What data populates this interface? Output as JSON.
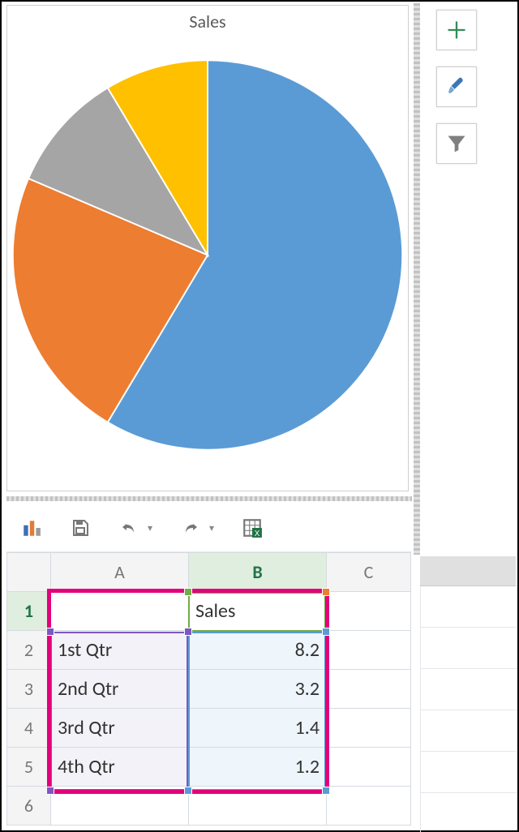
{
  "chart_data": {
    "type": "pie",
    "title": "Sales",
    "categories": [
      "1st Qtr",
      "2nd Qtr",
      "3rd Qtr",
      "4th Qtr"
    ],
    "values": [
      8.2,
      3.2,
      1.4,
      1.2
    ],
    "colors": [
      "#5b9bd5",
      "#ed7d31",
      "#a5a5a5",
      "#ffc000"
    ]
  },
  "side_buttons": {
    "add": "plus-icon",
    "styles": "paintbrush-icon",
    "filter": "funnel-icon"
  },
  "qat": {
    "chart_type": "chart-type-icon",
    "save": "save-icon",
    "undo": "undo-icon",
    "redo": "redo-icon",
    "sheet": "excel-sheet-icon"
  },
  "sheet": {
    "columns": [
      "A",
      "B",
      "C"
    ],
    "active_col": "B",
    "rows": [
      {
        "n": 1,
        "active": true,
        "A": "",
        "B": "Sales"
      },
      {
        "n": 2,
        "active": false,
        "A": "1st Qtr",
        "B": "8.2"
      },
      {
        "n": 3,
        "active": false,
        "A": "2nd Qtr",
        "B": "3.2"
      },
      {
        "n": 4,
        "active": false,
        "A": "3rd Qtr",
        "B": "1.4"
      },
      {
        "n": 5,
        "active": false,
        "A": "4th Qtr",
        "B": "1.2"
      },
      {
        "n": 6,
        "active": false,
        "A": "",
        "B": ""
      }
    ]
  }
}
